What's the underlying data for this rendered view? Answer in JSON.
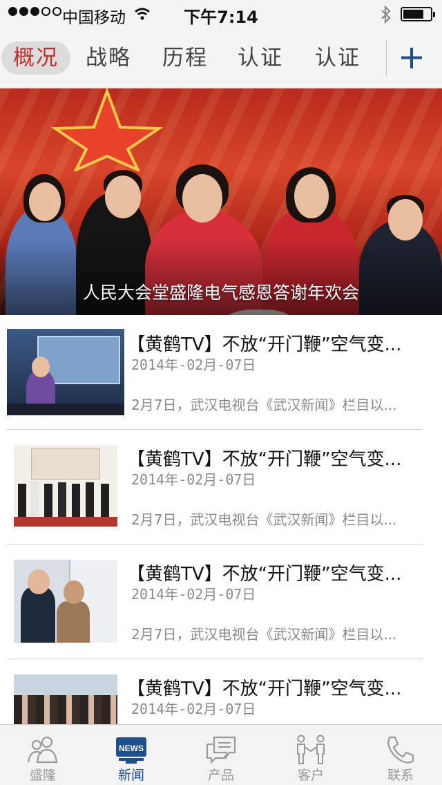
{
  "status_bar": {
    "carrier": "中国移动",
    "time": "下午7:14",
    "signal_bars_filled": 3,
    "signal_bars_total": 5,
    "battery_level": 0.75
  },
  "tabs": [
    {
      "label": "概况",
      "active": true
    },
    {
      "label": "战略",
      "active": false
    },
    {
      "label": "历程",
      "active": false
    },
    {
      "label": "认证",
      "active": false
    },
    {
      "label": "认证",
      "active": false
    }
  ],
  "add_icon": "plus-icon",
  "banner": {
    "caption": "人民大会堂盛隆电气感恩答谢年欢会"
  },
  "news": [
    {
      "title": "【黄鹤TV】不放“开门鞭”空气变...",
      "date": "2014年-02月-07日",
      "summary": "2月7日，武汉电视台《武汉新闻》栏目以..."
    },
    {
      "title": "【黄鹤TV】不放“开门鞭”空气变...",
      "date": "2014年-02月-07日",
      "summary": "2月7日，武汉电视台《武汉新闻》栏目以..."
    },
    {
      "title": "【黄鹤TV】不放“开门鞭”空气变...",
      "date": "2014年-02月-07日",
      "summary": "2月7日，武汉电视台《武汉新闻》栏目以..."
    },
    {
      "title": "【黄鹤TV】不放“开门鞭”空气变...",
      "date": "2014年-02月-07日",
      "summary": ""
    }
  ],
  "tab_bar": {
    "items": [
      {
        "label": "盛隆",
        "icon": "people-icon",
        "active": false
      },
      {
        "label": "新闻",
        "icon": "news-icon",
        "active": true,
        "icon_text": "NEWS"
      },
      {
        "label": "产品",
        "icon": "chat-bubbles-icon",
        "active": false
      },
      {
        "label": "客户",
        "icon": "handshake-icon",
        "active": false
      },
      {
        "label": "联系",
        "icon": "phone-icon",
        "active": false
      }
    ]
  },
  "colors": {
    "active_tab_text": "#c0302a",
    "accent_blue": "#1f4e8c",
    "muted_text": "#8a8a8a"
  }
}
